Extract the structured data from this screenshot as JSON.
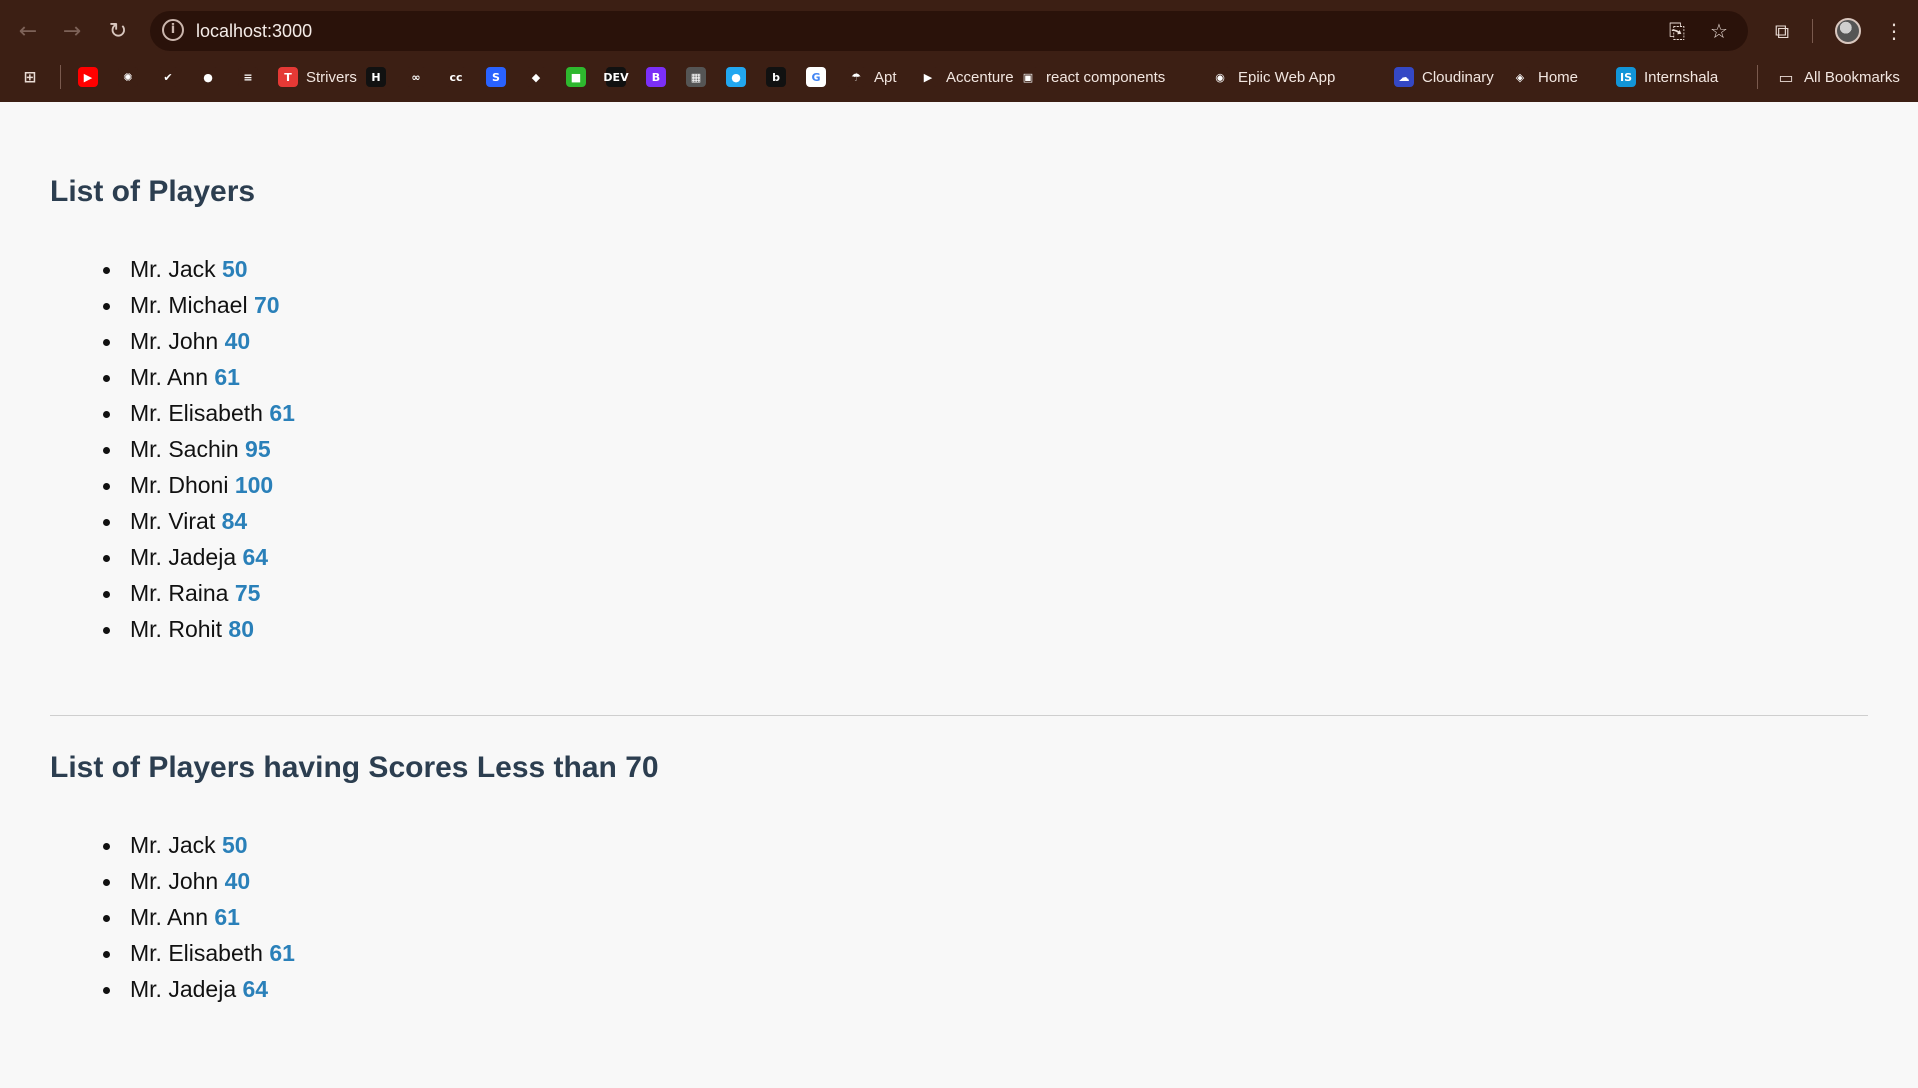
{
  "browser": {
    "url": "localhost:3000",
    "bookmarks": [
      {
        "label": "",
        "icon": "youtube-icon",
        "color": "#ff0000",
        "glyph": "▶"
      },
      {
        "label": "",
        "icon": "chatgpt-icon",
        "color": "#3c1f14",
        "glyph": "✺"
      },
      {
        "label": "",
        "icon": "bird-icon",
        "color": "#3c1f14",
        "glyph": "✔"
      },
      {
        "label": "",
        "icon": "github-icon",
        "color": "#3c1f14",
        "glyph": "●"
      },
      {
        "label": "",
        "icon": "stack-icon",
        "color": "#3c1f14",
        "glyph": "≡"
      },
      {
        "label": "Strivers",
        "icon": "tuf-icon",
        "color": "#e53935",
        "glyph": "T"
      },
      {
        "label": "",
        "icon": "hackerrank-icon",
        "color": "#111111",
        "glyph": "H"
      },
      {
        "label": "",
        "icon": "geeksforgeeks-icon",
        "color": "#3c1f14",
        "glyph": "∞"
      },
      {
        "label": "",
        "icon": "codechef-icon",
        "color": "#3c1f14",
        "glyph": "cc"
      },
      {
        "label": "",
        "icon": "s-icon",
        "color": "#2962ff",
        "glyph": "S"
      },
      {
        "label": "",
        "icon": "figma-icon",
        "color": "#3c1f14",
        "glyph": "◆"
      },
      {
        "label": "",
        "icon": "green-app-icon",
        "color": "#2eb82e",
        "glyph": "■"
      },
      {
        "label": "",
        "icon": "dev-icon",
        "color": "#111111",
        "glyph": "DEV"
      },
      {
        "label": "",
        "icon": "bootstrap-icon",
        "color": "#7b2ff7",
        "glyph": "B"
      },
      {
        "label": "",
        "icon": "grid-app-icon",
        "color": "#555555",
        "glyph": "▦"
      },
      {
        "label": "",
        "icon": "circle-app-icon",
        "color": "#22a7f0",
        "glyph": "●"
      },
      {
        "label": "",
        "icon": "b-app-icon",
        "color": "#111111",
        "glyph": "b"
      },
      {
        "label": "",
        "icon": "google-icon",
        "color": "#ffffff",
        "glyph": "G"
      },
      {
        "label": "Apt",
        "icon": "apt-icon",
        "color": "#3c1f14",
        "glyph": "☂"
      },
      {
        "label": "Accenture",
        "icon": "accenture-icon",
        "color": "#3c1f14",
        "glyph": "▶"
      },
      {
        "label": "react components",
        "icon": "react-components-icon",
        "color": "#3c1f14",
        "glyph": "▣"
      },
      {
        "label": "Epiic Web App",
        "icon": "epiic-icon",
        "color": "#3c1f14",
        "glyph": "◉"
      },
      {
        "label": "Cloudinary",
        "icon": "cloudinary-icon",
        "color": "#3448c5",
        "glyph": "☁"
      },
      {
        "label": "Home",
        "icon": "home-app-icon",
        "color": "#3c1f14",
        "glyph": "◈"
      },
      {
        "label": "Internshala",
        "icon": "internshala-icon",
        "color": "#1295d8",
        "glyph": "IS"
      }
    ],
    "all_bookmarks_label": "All Bookmarks"
  },
  "page": {
    "all_players_title": "List of Players",
    "all_players": [
      {
        "name": "Mr. Jack",
        "score": "50"
      },
      {
        "name": "Mr. Michael",
        "score": "70"
      },
      {
        "name": "Mr. John",
        "score": "40"
      },
      {
        "name": "Mr. Ann",
        "score": "61"
      },
      {
        "name": "Mr. Elisabeth",
        "score": "61"
      },
      {
        "name": "Mr. Sachin",
        "score": "95"
      },
      {
        "name": "Mr. Dhoni",
        "score": "100"
      },
      {
        "name": "Mr. Virat",
        "score": "84"
      },
      {
        "name": "Mr. Jadeja",
        "score": "64"
      },
      {
        "name": "Mr. Raina",
        "score": "75"
      },
      {
        "name": "Mr. Rohit",
        "score": "80"
      }
    ],
    "low_players_title": "List of Players having Scores Less than 70",
    "low_players": [
      {
        "name": "Mr. Jack",
        "score": "50"
      },
      {
        "name": "Mr. John",
        "score": "40"
      },
      {
        "name": "Mr. Ann",
        "score": "61"
      },
      {
        "name": "Mr. Elisabeth",
        "score": "61"
      },
      {
        "name": "Mr. Jadeja",
        "score": "64"
      }
    ]
  }
}
